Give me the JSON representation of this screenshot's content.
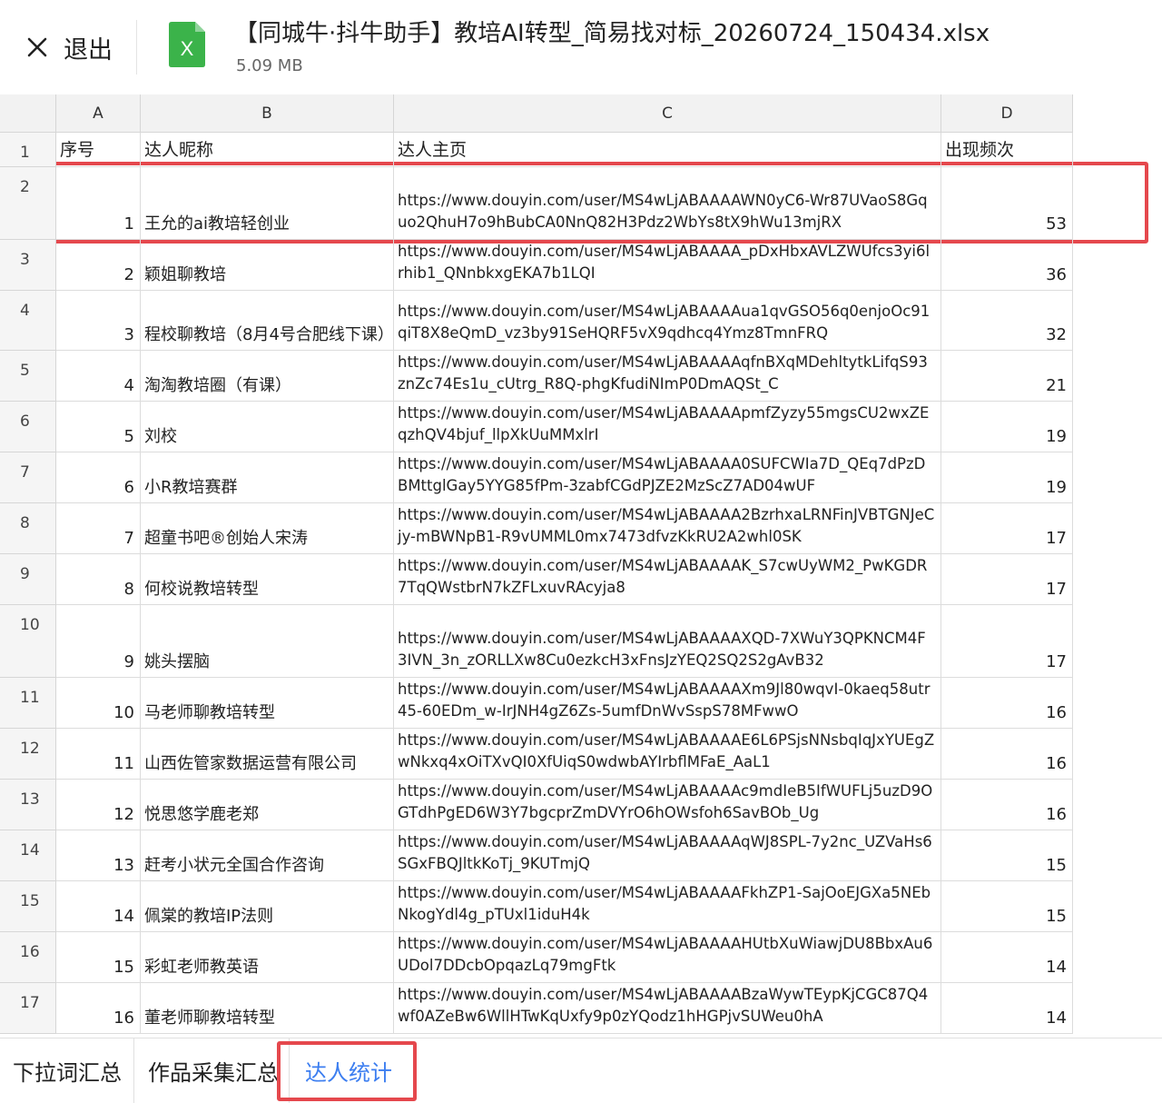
{
  "header": {
    "exit_label": "退出",
    "file_title": "【同城牛·抖牛助手】教培AI转型_简易找对标_20260724_150434.xlsx",
    "file_size": "5.09 MB",
    "file_icon_letter": "X",
    "file_icon_color": "#3bb34a"
  },
  "columns": [
    "A",
    "B",
    "C",
    "D"
  ],
  "header_row": {
    "row_num": "1",
    "a": "序号",
    "b": "达人昵称",
    "c": "达人主页",
    "d": "出现频次"
  },
  "rows": [
    {
      "row_num": "2",
      "seq": "1",
      "name": "王允的ai教培轻创业",
      "url": "https://www.douyin.com/user/MS4wLjABAAAAWN0yC6-Wr87UVaoS8Gquo2QhuH7o9hBubCA0NnQ82H3Pdz2WbYs8tX9hWu13mjRX",
      "freq": "53"
    },
    {
      "row_num": "3",
      "seq": "2",
      "name": "颖姐聊教培",
      "url": "https://www.douyin.com/user/MS4wLjABAAAA_pDxHbxAVLZWUfcs3yi6lrhib1_QNnbkxgEKA7b1LQI",
      "freq": "36"
    },
    {
      "row_num": "4",
      "seq": "3",
      "name": "程校聊教培（8月4号合肥线下课）",
      "url": "https://www.douyin.com/user/MS4wLjABAAAAua1qvGSO56q0enjoOc91qiT8X8eQmD_vz3by91SeHQRF5vX9qdhcq4Ymz8TmnFRQ",
      "freq": "32"
    },
    {
      "row_num": "5",
      "seq": "4",
      "name": "淘淘教培圈（有课）",
      "url": "https://www.douyin.com/user/MS4wLjABAAAAqfnBXqMDehltytkLifqS93znZc74Es1u_cUtrg_R8Q-phgKfudiNImP0DmAQSt_C",
      "freq": "21"
    },
    {
      "row_num": "6",
      "seq": "5",
      "name": "刘校",
      "url": "https://www.douyin.com/user/MS4wLjABAAAApmfZyzy55mgsCU2wxZEqzhQV4bjuf_llpXkUuMMxlrI",
      "freq": "19"
    },
    {
      "row_num": "7",
      "seq": "6",
      "name": "小R教培赛群",
      "url": "https://www.douyin.com/user/MS4wLjABAAAA0SUFCWIa7D_QEq7dPzDBMttglGay5YYG85fPm-3zabfCGdPJZE2MzScZ7AD04wUF",
      "freq": "19"
    },
    {
      "row_num": "8",
      "seq": "7",
      "name": "超童书吧®创始人宋涛",
      "url": "https://www.douyin.com/user/MS4wLjABAAAA2BzrhxaLRNFinJVBTGNJeCjy-mBWNpB1-R9vUMML0mx7473dfvzKkRU2A2whl0SK",
      "freq": "17"
    },
    {
      "row_num": "9",
      "seq": "8",
      "name": "何校说教培转型",
      "url": "https://www.douyin.com/user/MS4wLjABAAAAK_S7cwUyWM2_PwKGDR7TqQWstbrN7kZFLxuvRAcyja8",
      "freq": "17"
    },
    {
      "row_num": "10",
      "seq": "9",
      "name": "姚头摆脑",
      "url": "https://www.douyin.com/user/MS4wLjABAAAAXQD-7XWuY3QPKNCM4F3IVN_3n_zORLLXw8Cu0ezkcH3xFnsJzYEQ2SQ2S2gAvB32",
      "freq": "17"
    },
    {
      "row_num": "11",
      "seq": "10",
      "name": "马老师聊教培转型",
      "url": "https://www.douyin.com/user/MS4wLjABAAAAXm9Jl80wqvI-0kaeq58utr45-60EDm_w-IrJNH4gZ6Zs-5umfDnWvSspS78MFwwO",
      "freq": "16"
    },
    {
      "row_num": "12",
      "seq": "11",
      "name": "山西佐管家数据运营有限公司",
      "url": "https://www.douyin.com/user/MS4wLjABAAAAE6L6PSjsNNsbqIqJxYUEgZwNkxq4xOiTXvQI0XfUiqS0wdwbAYIrbflMFaE_AaL1",
      "freq": "16"
    },
    {
      "row_num": "13",
      "seq": "12",
      "name": "悦思悠学鹿老郑",
      "url": "https://www.douyin.com/user/MS4wLjABAAAAc9mdIeB5IfWUFLj5uzD9OGTdhPgED6W3Y7bgcprZmDVYrO6hOWsfoh6SavBOb_Ug",
      "freq": "16"
    },
    {
      "row_num": "14",
      "seq": "13",
      "name": "赶考小状元全国合作咨询",
      "url": "https://www.douyin.com/user/MS4wLjABAAAAqWJ8SPL-7y2nc_UZVaHs6SGxFBQJltkKoTj_9KUTmjQ",
      "freq": "15"
    },
    {
      "row_num": "15",
      "seq": "14",
      "name": "佩棠的教培IP法则",
      "url": "https://www.douyin.com/user/MS4wLjABAAAAFkhZP1-SajOoEJGXa5NEbNkogYdl4g_pTUxl1iduH4k",
      "freq": "15"
    },
    {
      "row_num": "16",
      "seq": "15",
      "name": "彩虹老师教英语",
      "url": "https://www.douyin.com/user/MS4wLjABAAAAHUtbXuWiawjDU8BbxAu6UDol7DDcbOpqazLq79mgFtk",
      "freq": "14"
    },
    {
      "row_num": "17",
      "seq": "16",
      "name": "董老师聊教培转型",
      "url": "https://www.douyin.com/user/MS4wLjABAAAABzaWywTEypKjCGC87Q4wf0AZeBw6WllHTwKqUxfy9p0zYQodz1hHGPjvSUWeu0hA",
      "freq": "14"
    }
  ],
  "sheet_tabs": [
    {
      "label": "下拉词汇总",
      "active": false
    },
    {
      "label": "作品采集汇总",
      "active": false
    },
    {
      "label": "达人统计",
      "active": true
    }
  ],
  "colors": {
    "accent": "#3c7ef0",
    "highlight": "#e5484d",
    "excel_green": "#3bb34a",
    "header_bg": "#f2f2f2"
  }
}
